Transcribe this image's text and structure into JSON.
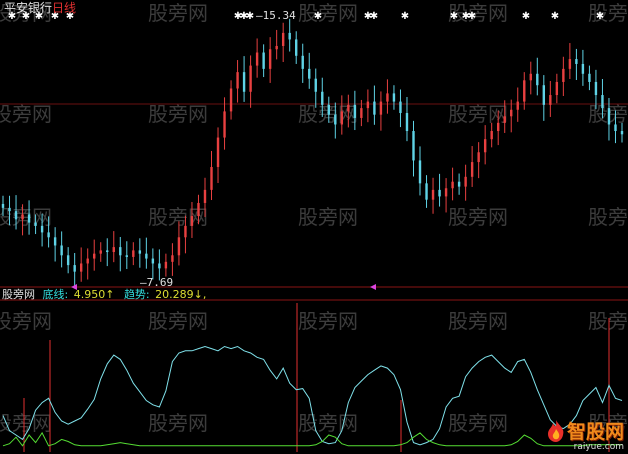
{
  "header": {
    "stock_name": "平安银行",
    "period": "日线"
  },
  "price_labels": {
    "high": "15.34",
    "low": "7.69"
  },
  "indicator": {
    "source": "股旁网",
    "base_label": "底线:",
    "base_value": "4.950",
    "base_arrow": "↑",
    "trend_label": "趋势:",
    "trend_value": "20.289",
    "trend_arrow": "↓",
    "trend_tail": ","
  },
  "watermark": "股旁网",
  "brand": {
    "name": "智股网",
    "url": "raiyue.com"
  },
  "colors": {
    "background": "#000000",
    "candle_up": "#e84040",
    "candle_down": "#5fd3e6",
    "trend_line": "#7fe1ea",
    "base_line": "#55dd33",
    "signal_line": "#e23030",
    "marker": "#ffffff",
    "arrow_marker": "#dd44dd",
    "header_name": "#e0e0e0",
    "header_period": "#e03030",
    "indicator_source": "#e0e0e0",
    "indicator_text": "#33dddd",
    "indicator_value": "#dddd33"
  },
  "chart_data": [
    {
      "type": "candlestick",
      "price_range": [
        7.3,
        15.8
      ],
      "high": 15.34,
      "low": 7.69,
      "close": [
        9.75,
        9.65,
        9.4,
        9.55,
        9.3,
        9.2,
        9.0,
        8.85,
        8.6,
        8.3,
        8.0,
        7.8,
        8.05,
        8.2,
        8.35,
        8.45,
        8.4,
        8.55,
        8.3,
        8.25,
        8.45,
        8.35,
        8.2,
        8.05,
        7.9,
        8.1,
        8.3,
        8.85,
        9.2,
        9.5,
        9.9,
        10.3,
        11.0,
        11.9,
        12.7,
        13.4,
        13.9,
        13.3,
        14.1,
        14.5,
        14.0,
        14.6,
        14.7,
        15.1,
        14.9,
        14.4,
        14.0,
        13.7,
        13.3,
        12.9,
        12.6,
        12.3,
        12.7,
        12.9,
        12.5,
        12.8,
        13.0,
        12.6,
        13.0,
        13.25,
        13.0,
        12.65,
        12.1,
        11.2,
        10.5,
        10.0,
        10.3,
        10.1,
        10.35,
        10.55,
        10.4,
        10.7,
        11.15,
        11.45,
        11.85,
        12.1,
        12.35,
        12.55,
        12.75,
        13.0,
        13.65,
        13.85,
        13.5,
        12.9,
        13.2,
        13.6,
        14.0,
        14.3,
        14.15,
        13.85,
        13.6,
        13.2,
        12.8,
        12.3,
        12.1,
        12.0
      ]
    },
    {
      "type": "line",
      "ylim": [
        0,
        100
      ],
      "series": [
        {
          "key": "trend",
          "values": [
            30,
            16,
            12,
            8,
            18,
            35,
            42,
            46,
            33,
            25,
            22,
            25,
            28,
            36,
            45,
            64,
            78,
            86,
            82,
            72,
            60,
            52,
            44,
            40,
            38,
            53,
            80,
            88,
            90,
            90,
            92,
            94,
            92,
            90,
            94,
            92,
            94,
            90,
            88,
            84,
            82,
            72,
            64,
            74,
            60,
            54,
            55,
            46,
            16,
            6,
            4,
            5,
            16,
            42,
            56,
            62,
            68,
            72,
            76,
            74,
            68,
            54,
            24,
            5,
            3,
            5,
            8,
            18,
            38,
            46,
            48,
            66,
            74,
            80,
            84,
            86,
            80,
            74,
            70,
            80,
            82,
            70,
            54,
            40,
            26,
            20,
            18,
            22,
            30,
            44,
            50,
            56,
            42,
            58,
            46,
            44
          ]
        },
        {
          "key": "base",
          "values": [
            2,
            4,
            10,
            2,
            12,
            5,
            14,
            2,
            4,
            8,
            6,
            3,
            2,
            2,
            2,
            2,
            3,
            4,
            5,
            4,
            3,
            2,
            2,
            2,
            2,
            2,
            2,
            2,
            2,
            2,
            2,
            2,
            2,
            2,
            2,
            2,
            2,
            2,
            2,
            2,
            2,
            2,
            2,
            2,
            2,
            2,
            2,
            2,
            3,
            6,
            12,
            10,
            4,
            2,
            2,
            2,
            2,
            2,
            2,
            2,
            2,
            3,
            5,
            10,
            14,
            8,
            5,
            3,
            2,
            2,
            2,
            2,
            2,
            2,
            2,
            2,
            2,
            2,
            3,
            6,
            12,
            9,
            4,
            2,
            2,
            2,
            2,
            2,
            2,
            2,
            3,
            3,
            3,
            3,
            3,
            3
          ]
        }
      ]
    }
  ]
}
